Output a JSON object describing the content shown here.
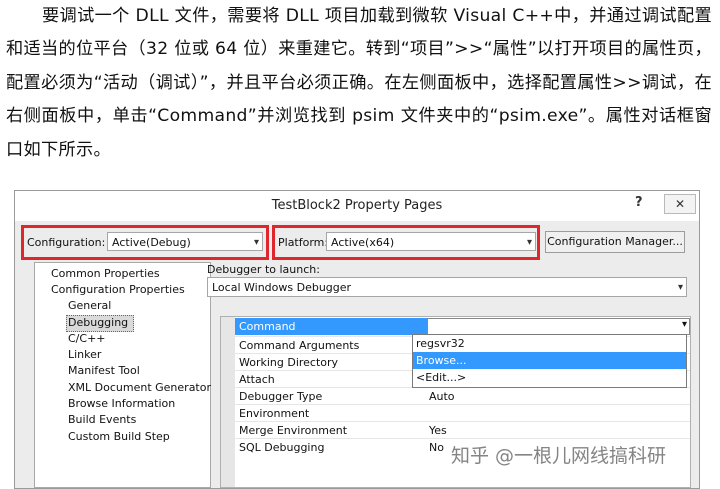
{
  "paragraph": "要调试一个 DLL 文件，需要将 DLL 项目加载到微软 Visual C++中，并通过调试配置和适当的位平台（32 位或 64 位）来重建它。转到“项目”>>“属性”以打开项目的属性页，配置必须为“活动（调试）”，并且平台必须正确。在左侧面板中，选择配置属性>>调试，在右侧面板中，单击“Command”并浏览找到 psim 文件夹中的“psim.exe”。属性对话框窗口如下所示。",
  "dialog": {
    "title": "TestBlock2 Property Pages",
    "help_glyph": "?",
    "close_glyph": "✕",
    "configuration_label": "Configuration:",
    "configuration_value": "Active(Debug)",
    "platform_label": "Platform:",
    "platform_value": "Active(x64)",
    "config_manager_label": "Configuration Manager...",
    "debugger_label": "Debugger to launch:",
    "debugger_value": "Local Windows Debugger",
    "tree": [
      {
        "label": "Common Properties",
        "level": 1
      },
      {
        "label": "Configuration Properties",
        "level": 1
      },
      {
        "label": "General",
        "level": 2
      },
      {
        "label": "Debugging",
        "level": 2,
        "selected": true
      },
      {
        "label": "C/C++",
        "level": 2
      },
      {
        "label": "Linker",
        "level": 2
      },
      {
        "label": "Manifest Tool",
        "level": 2
      },
      {
        "label": "XML Document Generator",
        "level": 2
      },
      {
        "label": "Browse Information",
        "level": 2
      },
      {
        "label": "Build Events",
        "level": 2
      },
      {
        "label": "Custom Build Step",
        "level": 2
      }
    ],
    "properties": [
      {
        "name": "Command",
        "value": "",
        "selected": true
      },
      {
        "name": "Command Arguments",
        "value": "regsvr32"
      },
      {
        "name": "Working Directory",
        "value": ""
      },
      {
        "name": "Attach",
        "value": ""
      },
      {
        "name": "Debugger Type",
        "value": "Auto"
      },
      {
        "name": "Environment",
        "value": ""
      },
      {
        "name": "Merge Environment",
        "value": "Yes"
      },
      {
        "name": "SQL Debugging",
        "value": "No"
      }
    ],
    "dropdown_options": [
      {
        "label": "regsvr32"
      },
      {
        "label": "Browse...",
        "highlighted": true
      },
      {
        "label": "<Edit...>"
      }
    ],
    "colors": {
      "highlight": "#3399ff",
      "red_box": "#e0262d"
    }
  },
  "watermark": "知乎 @一根儿网线搞科研"
}
